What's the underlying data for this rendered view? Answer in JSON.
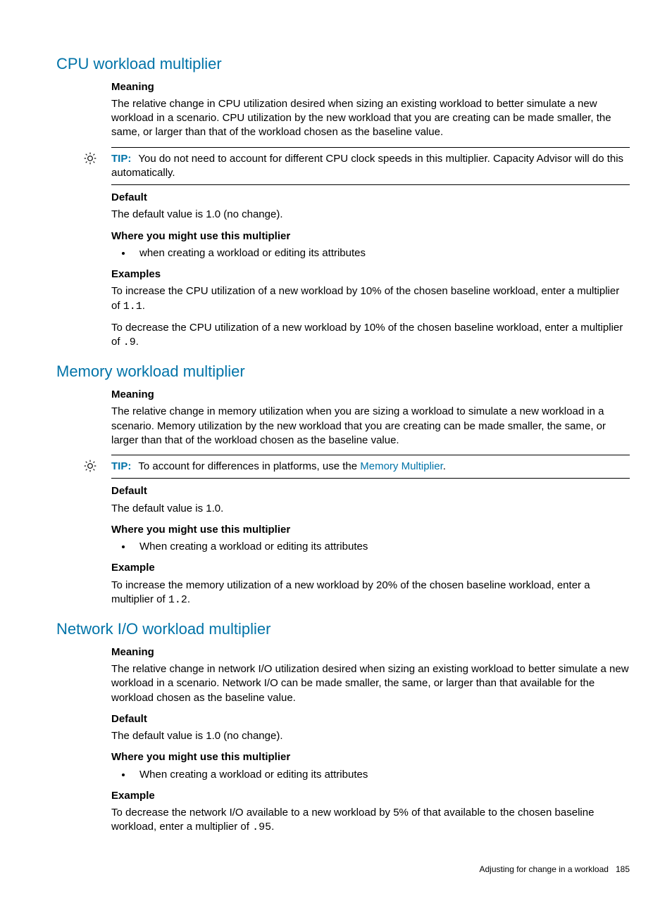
{
  "sections": {
    "cpu": {
      "title": "CPU workload multiplier",
      "meaning_label": "Meaning",
      "meaning_text": "The relative change in CPU utilization desired when sizing an existing workload to better simulate a new workload in a scenario. CPU utilization by the new workload that you are creating can be made smaller, the same, or larger than that of the workload chosen as the baseline value.",
      "tip_label": "TIP:",
      "tip_text": "You do not need to account for different CPU clock speeds in this multiplier. Capacity Advisor will do this automatically.",
      "default_label": "Default",
      "default_text": "The default value is 1.0 (no change).",
      "where_label": "Where you might use this multiplier",
      "where_item": "when creating a workload or editing its attributes",
      "examples_label": "Examples",
      "example_inc_pre": "To increase the CPU utilization of a new workload by 10% of the chosen baseline workload, enter a multiplier of ",
      "example_inc_code": "1.1",
      "example_inc_post": ".",
      "example_dec_pre": "To decrease the CPU utilization of a new workload by 10% of the chosen baseline workload, enter a multiplier of ",
      "example_dec_code": ".9",
      "example_dec_post": "."
    },
    "memory": {
      "title": "Memory workload multiplier",
      "meaning_label": "Meaning",
      "meaning_text": "The relative change in memory utilization when you are sizing a workload to simulate a new workload in a scenario. Memory utilization by the new workload that you are creating can be made smaller, the same, or larger than that of the workload chosen as the baseline value.",
      "tip_label": "TIP:",
      "tip_text_pre": "To account for differences in platforms, use the ",
      "tip_link": "Memory Multiplier",
      "tip_text_post": ".",
      "default_label": "Default",
      "default_text": "The default value is 1.0.",
      "where_label": "Where you might use this multiplier",
      "where_item": "When creating a workload or editing its attributes",
      "example_label": "Example",
      "example_pre": "To increase the memory utilization of a new workload by 20% of the chosen baseline workload, enter a multiplier of ",
      "example_code": "1.2",
      "example_post": "."
    },
    "network": {
      "title": "Network I/O workload multiplier",
      "meaning_label": "Meaning",
      "meaning_text": "The relative change in network I/O utilization desired when sizing an existing workload to better simulate a new workload in a scenario. Network I/O can be made smaller, the same, or larger than that available for the workload chosen as the baseline value.",
      "default_label": "Default",
      "default_text": "The default value is 1.0 (no change).",
      "where_label": "Where you might use this multiplier",
      "where_item": "When creating a workload or editing its attributes",
      "example_label": "Example",
      "example_pre": "To decrease the network I/O available to a new workload by 5% of that available to the chosen baseline workload, enter a multiplier of ",
      "example_code": ".95",
      "example_post": "."
    }
  },
  "footer": {
    "text": "Adjusting for change in a workload",
    "page": "185"
  }
}
